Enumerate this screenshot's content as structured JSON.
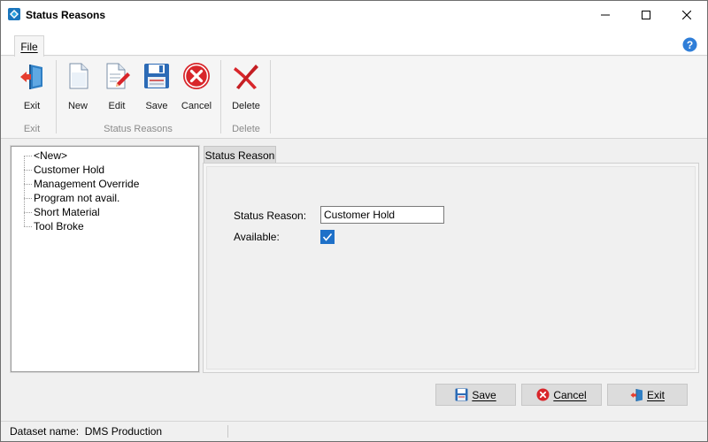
{
  "window": {
    "title": "Status Reasons",
    "icon": "diamond-app-icon",
    "controls": [
      "minimize-icon",
      "maximize-icon",
      "close-icon"
    ]
  },
  "ribbon": {
    "tabs": [
      {
        "label": "File",
        "active": true
      }
    ],
    "help_icon": "help-icon",
    "groups": [
      {
        "label": "Exit",
        "buttons": [
          {
            "label": "Exit",
            "icon": "exit-door-icon"
          }
        ]
      },
      {
        "label": "Status Reasons",
        "buttons": [
          {
            "label": "New",
            "icon": "new-document-icon"
          },
          {
            "label": "Edit",
            "icon": "edit-document-icon"
          },
          {
            "label": "Save",
            "icon": "floppy-disk-icon"
          },
          {
            "label": "Cancel",
            "icon": "cancel-circle-icon"
          }
        ]
      },
      {
        "label": "Delete",
        "buttons": [
          {
            "label": "Delete",
            "icon": "delete-x-icon"
          }
        ]
      }
    ]
  },
  "tree": {
    "items": [
      "<New>",
      "Customer Hold",
      "Management Override",
      "Program not avail.",
      "Short Material",
      "Tool Broke"
    ]
  },
  "detail": {
    "tab_label": "Status Reason",
    "status_reason_label": "Status Reason:",
    "status_reason_value": "Customer Hold",
    "available_label": "Available:",
    "available_checked": true
  },
  "footer": {
    "save_label": "Save",
    "cancel_label": "Cancel",
    "exit_label": "Exit"
  },
  "statusbar": {
    "text": "Dataset name:  DMS Production"
  },
  "colors": {
    "accent": "#1e70c8",
    "delete_red": "#d8262b",
    "button_face": "#dcdcdc"
  }
}
